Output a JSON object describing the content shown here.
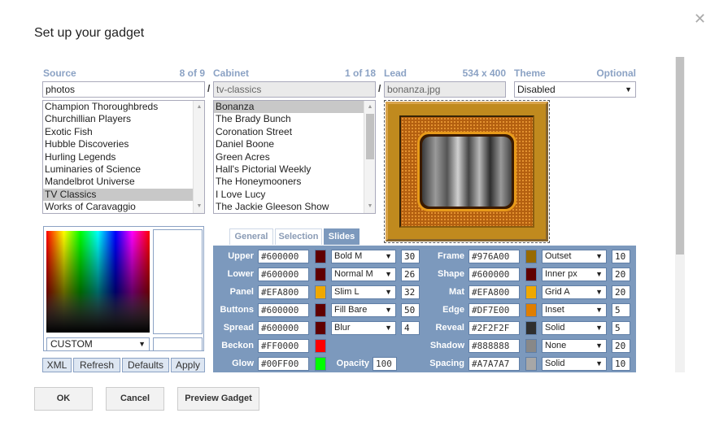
{
  "dialog": {
    "title": "Set up your gadget"
  },
  "source": {
    "label": "Source",
    "count": "8 of 9",
    "value": "photos",
    "items": [
      "Champion Thoroughbreds",
      "Churchillian Players",
      "Exotic Fish",
      "Hubble Discoveries",
      "Hurling Legends",
      "Luminaries of Science",
      "Mandelbrot Universe",
      "TV Classics",
      "Works of Caravaggio"
    ],
    "selected": "TV Classics"
  },
  "cabinet": {
    "label": "Cabinet",
    "count": "1 of 18",
    "value": "tv-classics",
    "items": [
      "Bonanza",
      "The Brady Bunch",
      "Coronation Street",
      "Daniel Boone",
      "Green Acres",
      "Hall's Pictorial Weekly",
      "The Honeymooners",
      "I Love Lucy",
      "The Jackie Gleeson Show"
    ],
    "selected": "Bonanza"
  },
  "lead": {
    "label": "Lead",
    "dims": "534 x 400",
    "value": "bonanza.jpg"
  },
  "theme": {
    "label": "Theme",
    "hint": "Optional",
    "value": "Disabled"
  },
  "separator": "/",
  "picker": {
    "mode": "CUSTOM",
    "buttons": [
      "XML",
      "Refresh",
      "Defaults",
      "Apply"
    ]
  },
  "tabs": [
    "General",
    "Selection",
    "Slides"
  ],
  "active_tab": "Slides",
  "slides": {
    "left": [
      {
        "label": "Upper",
        "hex": "#600000",
        "color": "#600000",
        "style": "Bold M",
        "num": "30"
      },
      {
        "label": "Lower",
        "hex": "#600000",
        "color": "#600000",
        "style": "Normal M",
        "num": "26"
      },
      {
        "label": "Panel",
        "hex": "#EFA800",
        "color": "#EFA800",
        "style": "Slim L",
        "num": "32"
      },
      {
        "label": "Buttons",
        "hex": "#600000",
        "color": "#600000",
        "style": "Fill Bare",
        "num": "50"
      },
      {
        "label": "Spread",
        "hex": "#600000",
        "color": "#600000",
        "style": "Blur",
        "num": "4"
      },
      {
        "label": "Beckon",
        "hex": "#FF0000",
        "color": "#FF0000"
      },
      {
        "label": "Glow",
        "hex": "#00FF00",
        "color": "#00FF00"
      }
    ],
    "opacity_label": "Opacity",
    "opacity_value": "100",
    "right": [
      {
        "label": "Frame",
        "hex": "#976A00",
        "color": "#976A00",
        "style": "Outset",
        "num": "10"
      },
      {
        "label": "Shape",
        "hex": "#600000",
        "color": "#600000",
        "style": "Inner px",
        "num": "20"
      },
      {
        "label": "Mat",
        "hex": "#EFA800",
        "color": "#EFA800",
        "style": "Grid A",
        "num": "20"
      },
      {
        "label": "Edge",
        "hex": "#DF7E00",
        "color": "#DF7E00",
        "style": "Inset",
        "num": "5"
      },
      {
        "label": "Reveal",
        "hex": "#2F2F2F",
        "color": "#2F2F2F",
        "style": "Solid",
        "num": "5"
      },
      {
        "label": "Shadow",
        "hex": "#888888",
        "color": "#888888",
        "style": "None",
        "num": "20"
      },
      {
        "label": "Spacing",
        "hex": "#A7A7A7",
        "color": "#A7A7A7",
        "style": "Solid",
        "num": "10"
      }
    ]
  },
  "footer": {
    "ok": "OK",
    "cancel": "Cancel",
    "preview": "Preview Gadget"
  }
}
